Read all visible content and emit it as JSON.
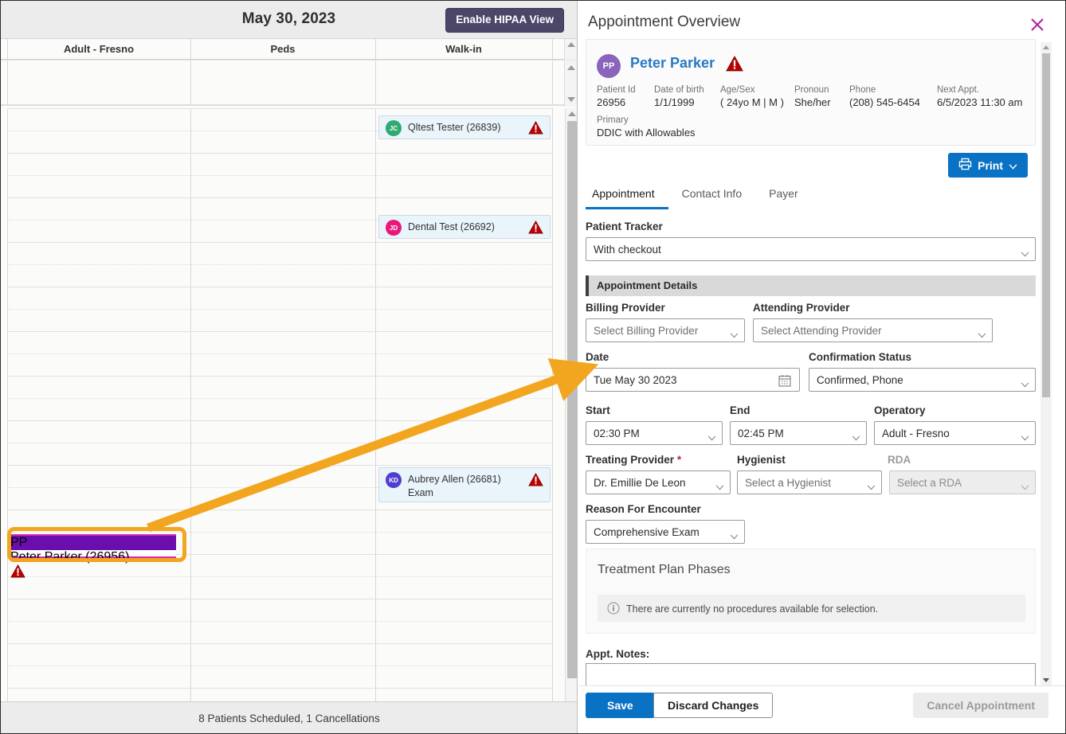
{
  "scheduler": {
    "date_title": "May 30, 2023",
    "hipaa_button": "Enable HIPAA View",
    "columns": [
      "Adult - Fresno",
      "Peds",
      "Walk-in"
    ],
    "footer_status": "8 Patients Scheduled,  1 Cancellations",
    "appointments": [
      {
        "name": "Qltest Tester (26839)",
        "sub": "",
        "initials": "JC",
        "avatar_color": "#2faa72",
        "column": "Walk-in",
        "has_alert": true
      },
      {
        "name": "Dental Test (26692)",
        "sub": "",
        "initials": "JD",
        "avatar_color": "#e8197d",
        "column": "Walk-in",
        "has_alert": true
      },
      {
        "name": "Aubrey Allen (26681)",
        "sub": "Exam",
        "initials": "KD",
        "avatar_color": "#4f3fd0",
        "column": "Walk-in",
        "has_alert": true
      },
      {
        "name": "Peter Parker (26956)",
        "sub": "",
        "initials": "PP",
        "avatar_color": "#6a0fad",
        "column": "Adult - Fresno",
        "has_alert": true,
        "selected": true
      }
    ]
  },
  "panel": {
    "title": "Appointment Overview",
    "close_label": "×",
    "patient": {
      "initials": "PP",
      "name": "Peter Parker",
      "fields": [
        {
          "label": "Patient Id",
          "value": "26956"
        },
        {
          "label": "Date of birth",
          "value": "1/1/1999"
        },
        {
          "label": "Age/Sex",
          "value": "( 24yo M | M )"
        },
        {
          "label": "Pronoun",
          "value": "She/her"
        },
        {
          "label": "Phone",
          "value": "(208) 545-6454"
        },
        {
          "label": "Next Appt.",
          "value": "6/5/2023 11:30 am"
        }
      ],
      "primary_label": "Primary",
      "primary_value": "DDIC with Allowables"
    },
    "print_button": "Print",
    "tabs": [
      {
        "label": "Appointment",
        "active": true
      },
      {
        "label": "Contact Info",
        "active": false
      },
      {
        "label": "Payer",
        "active": false
      }
    ],
    "patient_tracker": {
      "label": "Patient Tracker",
      "value": "With checkout"
    },
    "section_title": "Appointment Details",
    "fields": {
      "billing_provider": {
        "label": "Billing Provider",
        "value": "Select Billing Provider",
        "is_placeholder": true
      },
      "attending_provider": {
        "label": "Attending Provider",
        "value": "Select Attending Provider",
        "is_placeholder": true
      },
      "date": {
        "label": "Date",
        "value": "Tue May 30 2023"
      },
      "confirmation_status": {
        "label": "Confirmation Status",
        "value": "Confirmed, Phone"
      },
      "start": {
        "label": "Start",
        "value": "02:30 PM"
      },
      "end": {
        "label": "End",
        "value": "02:45 PM"
      },
      "operatory": {
        "label": "Operatory",
        "value": "Adult - Fresno"
      },
      "treating_provider": {
        "label": "Treating Provider",
        "required_mark": "*",
        "value": "Dr. Emillie De Leon"
      },
      "hygienist": {
        "label": "Hygienist",
        "value": "Select a Hygienist",
        "is_placeholder": true
      },
      "rda": {
        "label": "RDA",
        "value": "Select a RDA",
        "is_placeholder": true,
        "disabled": true
      },
      "reason_for_encounter": {
        "label": "Reason For Encounter",
        "value": "Comprehensive Exam"
      }
    },
    "treatment_plan": {
      "title": "Treatment Plan Phases",
      "info_text": "There are currently no procedures available for selection."
    },
    "notes": {
      "label": "Appt. Notes:",
      "value": "",
      "placeholder": ""
    },
    "footer": {
      "save": "Save",
      "discard": "Discard Changes",
      "cancel_appointment": "Cancel Appointment"
    }
  },
  "annotation": {
    "highlight_color": "#f2a51e",
    "type": "arrow-pointing-from-selected-appointment-to-date-field"
  },
  "colors": {
    "accent_blue": "#0a72c4",
    "hipaa_purple": "#4c4769",
    "alert_red": "#c00000",
    "highlight_orange": "#f2a51e",
    "link_blue": "#2878c4"
  }
}
